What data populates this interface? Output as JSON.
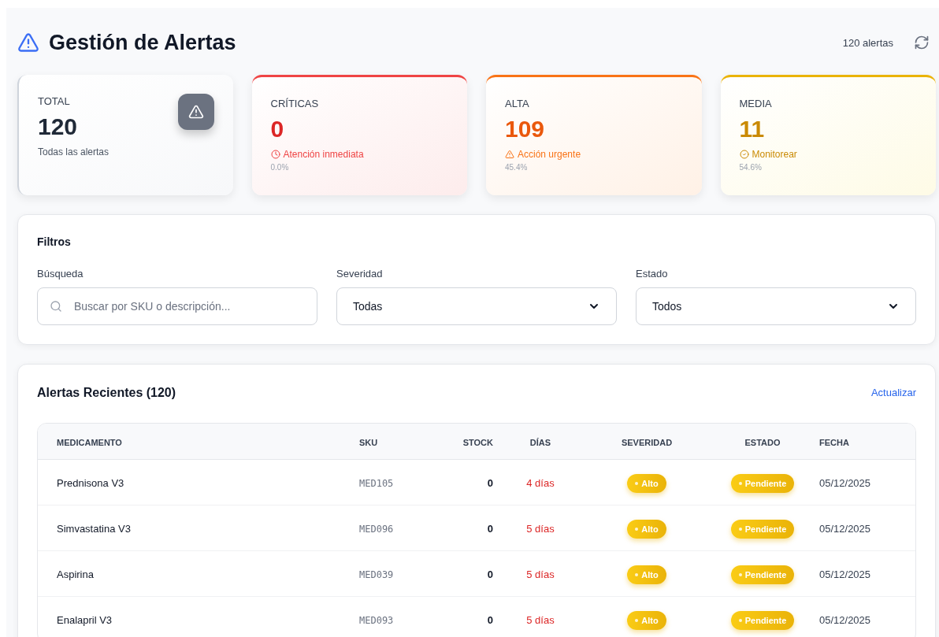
{
  "header": {
    "title": "Gestión de Alertas",
    "count": "120 alertas"
  },
  "stats": [
    {
      "kind": "total",
      "label": "TOTAL",
      "value": "120",
      "note": "Todas las alertas"
    },
    {
      "kind": "critical",
      "label": "CRÍTICAS",
      "value": "0",
      "note": "Atención inmediata",
      "percent": "0.0%"
    },
    {
      "kind": "high",
      "label": "ALTA",
      "value": "109",
      "note": "Acción urgente",
      "percent": "45.4%"
    },
    {
      "kind": "medium",
      "label": "MEDIA",
      "value": "11",
      "note": "Monitorear",
      "percent": "54.6%"
    }
  ],
  "filters": {
    "title": "Filtros",
    "search": {
      "label": "Búsqueda",
      "placeholder": "Buscar por SKU o descripción..."
    },
    "severity": {
      "label": "Severidad",
      "value": "Todas"
    },
    "status": {
      "label": "Estado",
      "value": "Todos"
    }
  },
  "table": {
    "title": "Alertas Recientes (120)",
    "action": "Actualizar",
    "columns": [
      "MEDICAMENTO",
      "SKU",
      "STOCK",
      "DÍAS",
      "SEVERIDAD",
      "ESTADO",
      "FECHA"
    ],
    "rows": [
      {
        "name": "Prednisona V3",
        "sku": "MED105",
        "stock": "0",
        "days": "4 días",
        "severity": {
          "label": "Alto",
          "kind": "high"
        },
        "status": {
          "label": "Pendiente",
          "kind": "pending"
        },
        "date": "05/12/2025"
      },
      {
        "name": "Simvastatina V3",
        "sku": "MED096",
        "stock": "0",
        "days": "5 días",
        "severity": {
          "label": "Alto",
          "kind": "high"
        },
        "status": {
          "label": "Pendiente",
          "kind": "pending"
        },
        "date": "05/12/2025"
      },
      {
        "name": "Aspirina",
        "sku": "MED039",
        "stock": "0",
        "days": "5 días",
        "severity": {
          "label": "Alto",
          "kind": "high"
        },
        "status": {
          "label": "Pendiente",
          "kind": "pending"
        },
        "date": "05/12/2025"
      },
      {
        "name": "Enalapril V3",
        "sku": "MED093",
        "stock": "0",
        "days": "5 días",
        "severity": {
          "label": "Alto",
          "kind": "high"
        },
        "status": {
          "label": "Pendiente",
          "kind": "pending"
        },
        "date": "05/12/2025"
      }
    ]
  }
}
